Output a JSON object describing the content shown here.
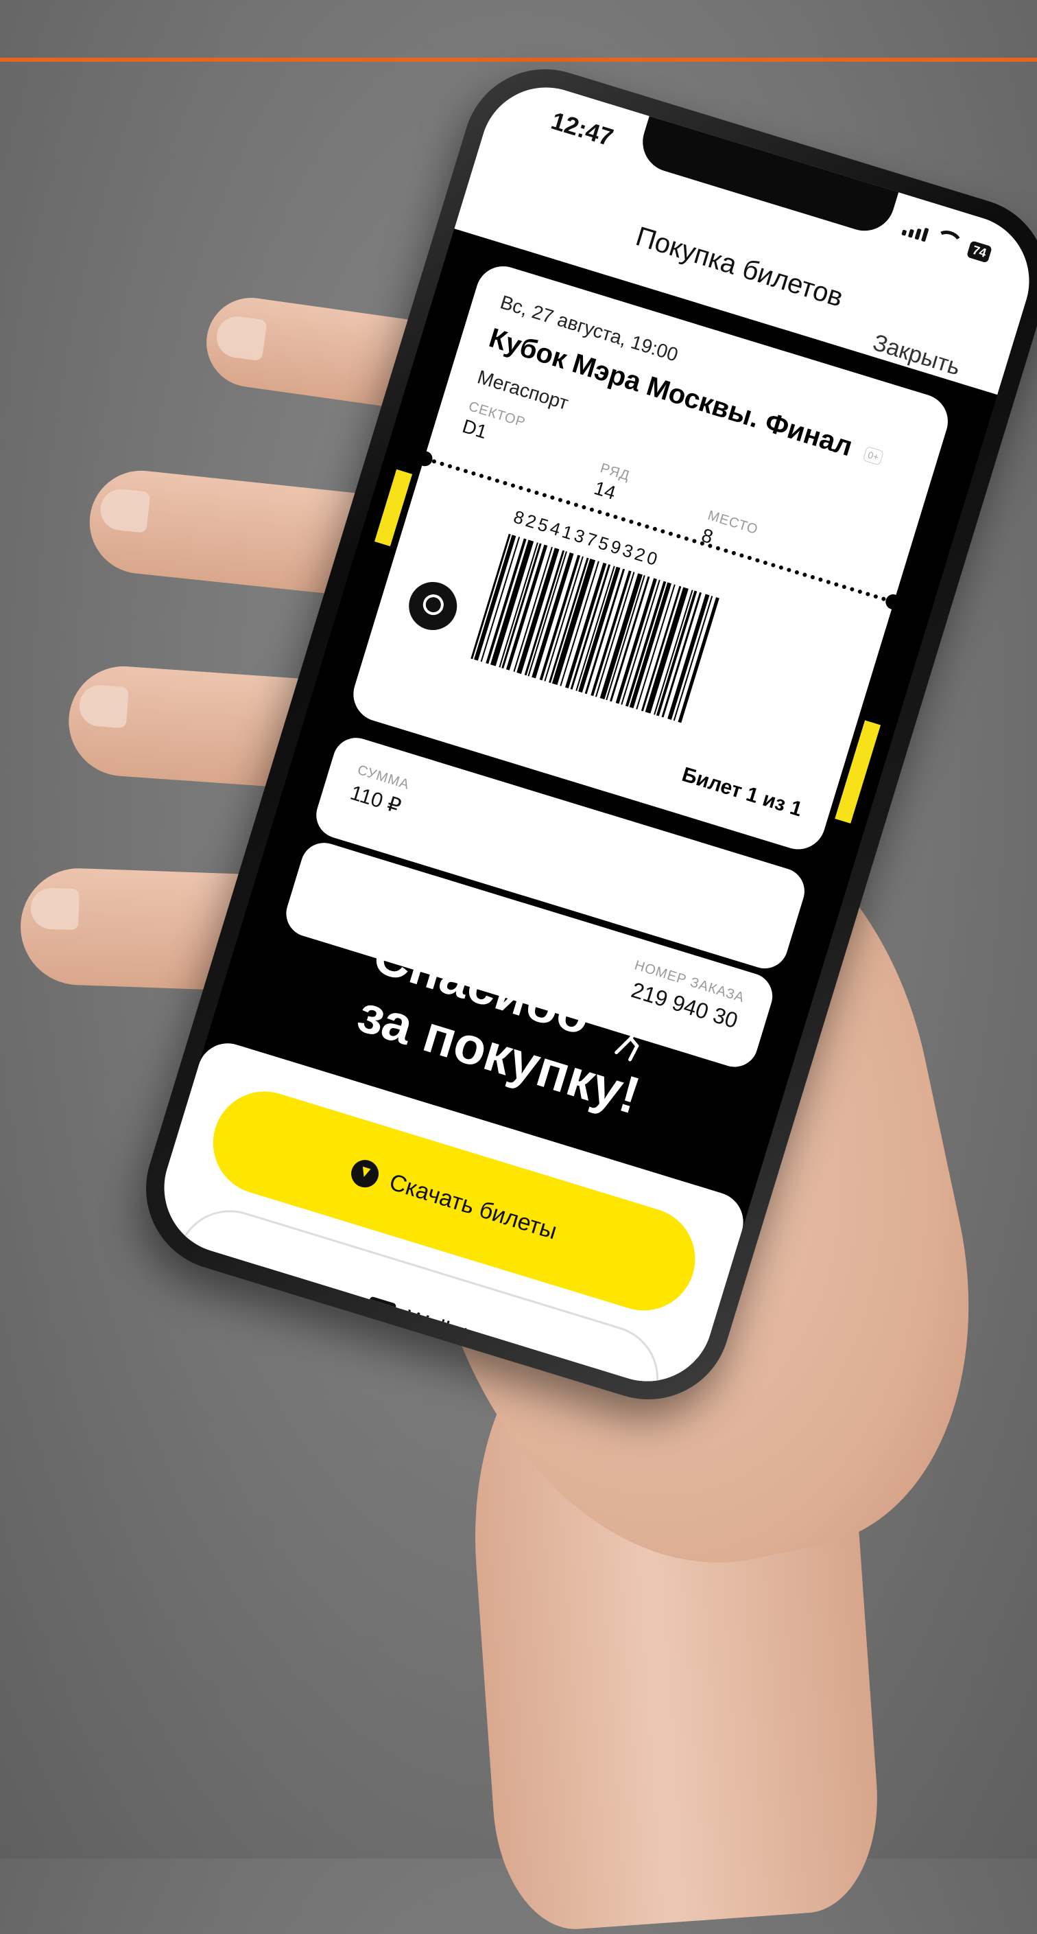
{
  "status_bar": {
    "time": "12:47",
    "battery": "74"
  },
  "header": {
    "title": "Покупка билетов",
    "close_label": "Закрыть"
  },
  "ticket": {
    "date": "Вс, 27 августа, 19:00",
    "event": "Кубок Мэра Москвы. Финал",
    "age_badge": "0+",
    "venue": "Мегаспорт",
    "sector_label": "СЕКТОР",
    "sector": "D1",
    "row_label": "РЯД",
    "row": "14",
    "seat_label": "МЕСТО",
    "seat": "8",
    "barcode_number": "825413759320",
    "ticket_count": "Билет 1 из 1"
  },
  "summary": {
    "sum_label": "СУММА",
    "sum": "110 ₽"
  },
  "order": {
    "order_label": "НОМЕР ЗАКАЗА",
    "order_number": "219 940 30"
  },
  "thanks": {
    "line1": "Спасибо",
    "line2": "за покупку!"
  },
  "actions": {
    "download_label": "Скачать билеты",
    "wallet_label": "Wallet"
  },
  "colors": {
    "accent_yellow": "#ffe600",
    "top_line": "#e8651d"
  }
}
